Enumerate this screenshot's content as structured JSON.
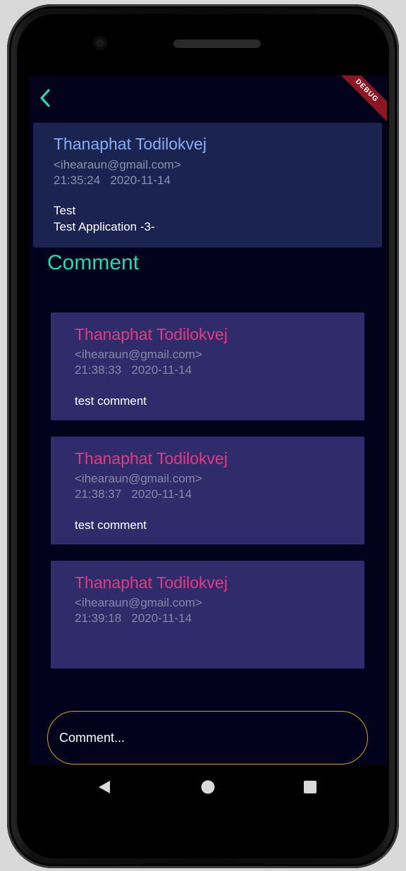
{
  "post": {
    "author_name": "Thanaphat Todilokvej",
    "author_email": "<ihearaun@gmail.com>",
    "time": "21:35:24",
    "date": "2020-11-14",
    "title": "Test",
    "body": "Test Application -3-"
  },
  "debug_label": "DEBUG",
  "comments_title": "Comment",
  "comments": [
    {
      "author_name": "Thanaphat Todilokvej",
      "author_email": "<ihearaun@gmail.com>",
      "time": "21:38:33",
      "date": "2020-11-14",
      "body": "test comment"
    },
    {
      "author_name": "Thanaphat Todilokvej",
      "author_email": "<ihearaun@gmail.com>",
      "time": "21:38:37",
      "date": "2020-11-14",
      "body": "test comment"
    },
    {
      "author_name": "Thanaphat Todilokvej",
      "author_email": "<ihearaun@gmail.com>",
      "time": "21:39:18",
      "date": "2020-11-14",
      "body": ""
    }
  ],
  "comment_input": {
    "placeholder": "Comment..."
  },
  "icons": {
    "back": "chevron-left-icon",
    "nav_back": "triangle-back-icon",
    "nav_home": "circle-home-icon",
    "nav_recents": "square-recents-icon"
  },
  "colors": {
    "accent": "#2fd6b4",
    "post_author": "#87aef5",
    "comment_author": "#e33a80",
    "input_border": "#d6a321",
    "screen_bg": "#02021c",
    "post_card_bg": "#1b2451",
    "comment_card_bg": "#302c6b"
  }
}
